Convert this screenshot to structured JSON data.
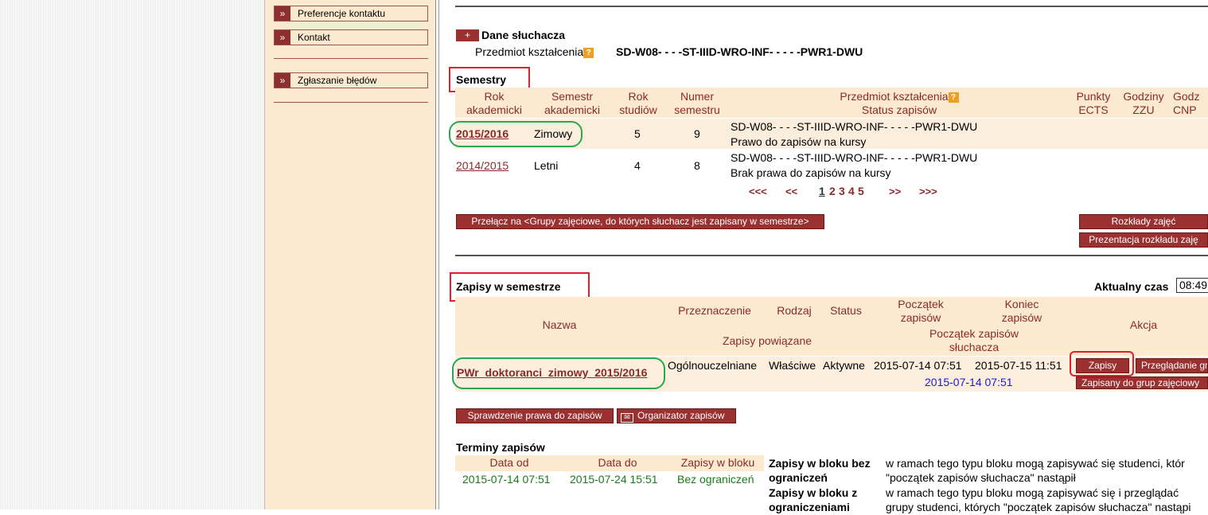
{
  "menu": {
    "items": [
      {
        "label": "Preferencje kontaktu"
      },
      {
        "label": "Kontakt"
      },
      {
        "label": "Zgłaszanie błędów"
      }
    ]
  },
  "student": {
    "toggle": "+",
    "title": "Dane słuchacza",
    "przedmiot_label": "Przedmiot kształcenia",
    "help": "?",
    "przedmiot_value": "SD-W08- - - -ST-IIID-WRO-INF- - - - -PWR1-DWU"
  },
  "semestry": {
    "title": "Semestry",
    "headers": {
      "rok": "Rok akademicki",
      "semestr": "Semestr akademicki",
      "rok_studiow": "Rok studiów",
      "numer": "Numer semestru",
      "przedmiot": "Przedmiot kształcenia",
      "status": "Status zapisów",
      "ects": "Punkty ECTS",
      "zzu": "Godziny ZZU",
      "cnps": "Godz CNP"
    },
    "rows": [
      {
        "rok": "2015/2016",
        "semestr": "Zimowy",
        "rok_studiow": "5",
        "numer": "9",
        "przedmiot": "SD-W08- - - -ST-IIID-WRO-INF- - - - -PWR1-DWU",
        "status": "Prawo do zapisów na kursy"
      },
      {
        "rok": "2014/2015",
        "semestr": "Letni",
        "rok_studiow": "4",
        "numer": "8",
        "przedmiot": "SD-W08- - - -ST-IIID-WRO-INF- - - - -PWR1-DWU",
        "status": "Brak prawa do zapisów na kursy"
      }
    ],
    "pagination": {
      "first": "<<<",
      "prev": "<<",
      "current": "1",
      "pages": [
        "2",
        "3",
        "4",
        "5"
      ],
      "next": ">>",
      "last": ">>>"
    },
    "switch_button": "Przełącz na <Grupy zajęciowe, do których słuchacz jest zapisany w semestrze>",
    "schedule_button": "Rozkłady zajęć",
    "presentation_button": "Prezentacja rozkładu zaję"
  },
  "zapisy": {
    "title": "Zapisy w semestrze",
    "time_label": "Aktualny czas",
    "time_value": "08:49",
    "headers": {
      "nazwa": "Nazwa",
      "przeznaczenie": "Przeznaczenie",
      "rodzaj": "Rodzaj",
      "status": "Status",
      "poczatek": "Początek zapisów",
      "koniec": "Koniec zapisów",
      "powiazane": "Zapisy powiązane",
      "poczatek_sluchacza": "Początek zapisów słuchacza",
      "akcja": "Akcja"
    },
    "row": {
      "nazwa": "PWr_doktoranci_zimowy_2015/2016",
      "przeznaczenie": "Ogólnouczelniane",
      "rodzaj": "Właściwe",
      "status": "Aktywne",
      "poczatek": "2015-07-14 07:51",
      "koniec": "2015-07-15 11:51",
      "poczatek_sluchacza": "2015-07-14 07:51",
      "zapisy_btn": "Zapisy",
      "przegladanie_btn": "Przeglądanie gr",
      "zapisany_btn": "Zapisany do grup zajęciowy"
    },
    "sprawdzenie_btn": "Sprawdzenie prawa do zapisów",
    "organizator_btn": "Organizator zapisów"
  },
  "terminy": {
    "title": "Terminy zapisów",
    "headers": {
      "od": "Data od",
      "do": "Data do",
      "blok": "Zapisy w bloku"
    },
    "row": {
      "od": "2015-07-14 07:51",
      "do": "2015-07-24 15:51",
      "blok": "Bez ograniczeń"
    },
    "legend": [
      {
        "term1": "Zapisy w bloku bez",
        "term2": "ograniczeń",
        "desc1": "w ramach tego typu bloku mogą zapisywać się studenci, któr",
        "desc2": "\"początek zapisów słuchacza\" nastąpił"
      },
      {
        "term1": "Zapisy w bloku z",
        "term2": "ograniczeniami",
        "desc1": "w ramach tego typu bloku mogą zapisywać się i przeglądać",
        "desc2": "grupy studenci, których \"początek zapisów słuchacza\" nastąpi"
      }
    ]
  }
}
